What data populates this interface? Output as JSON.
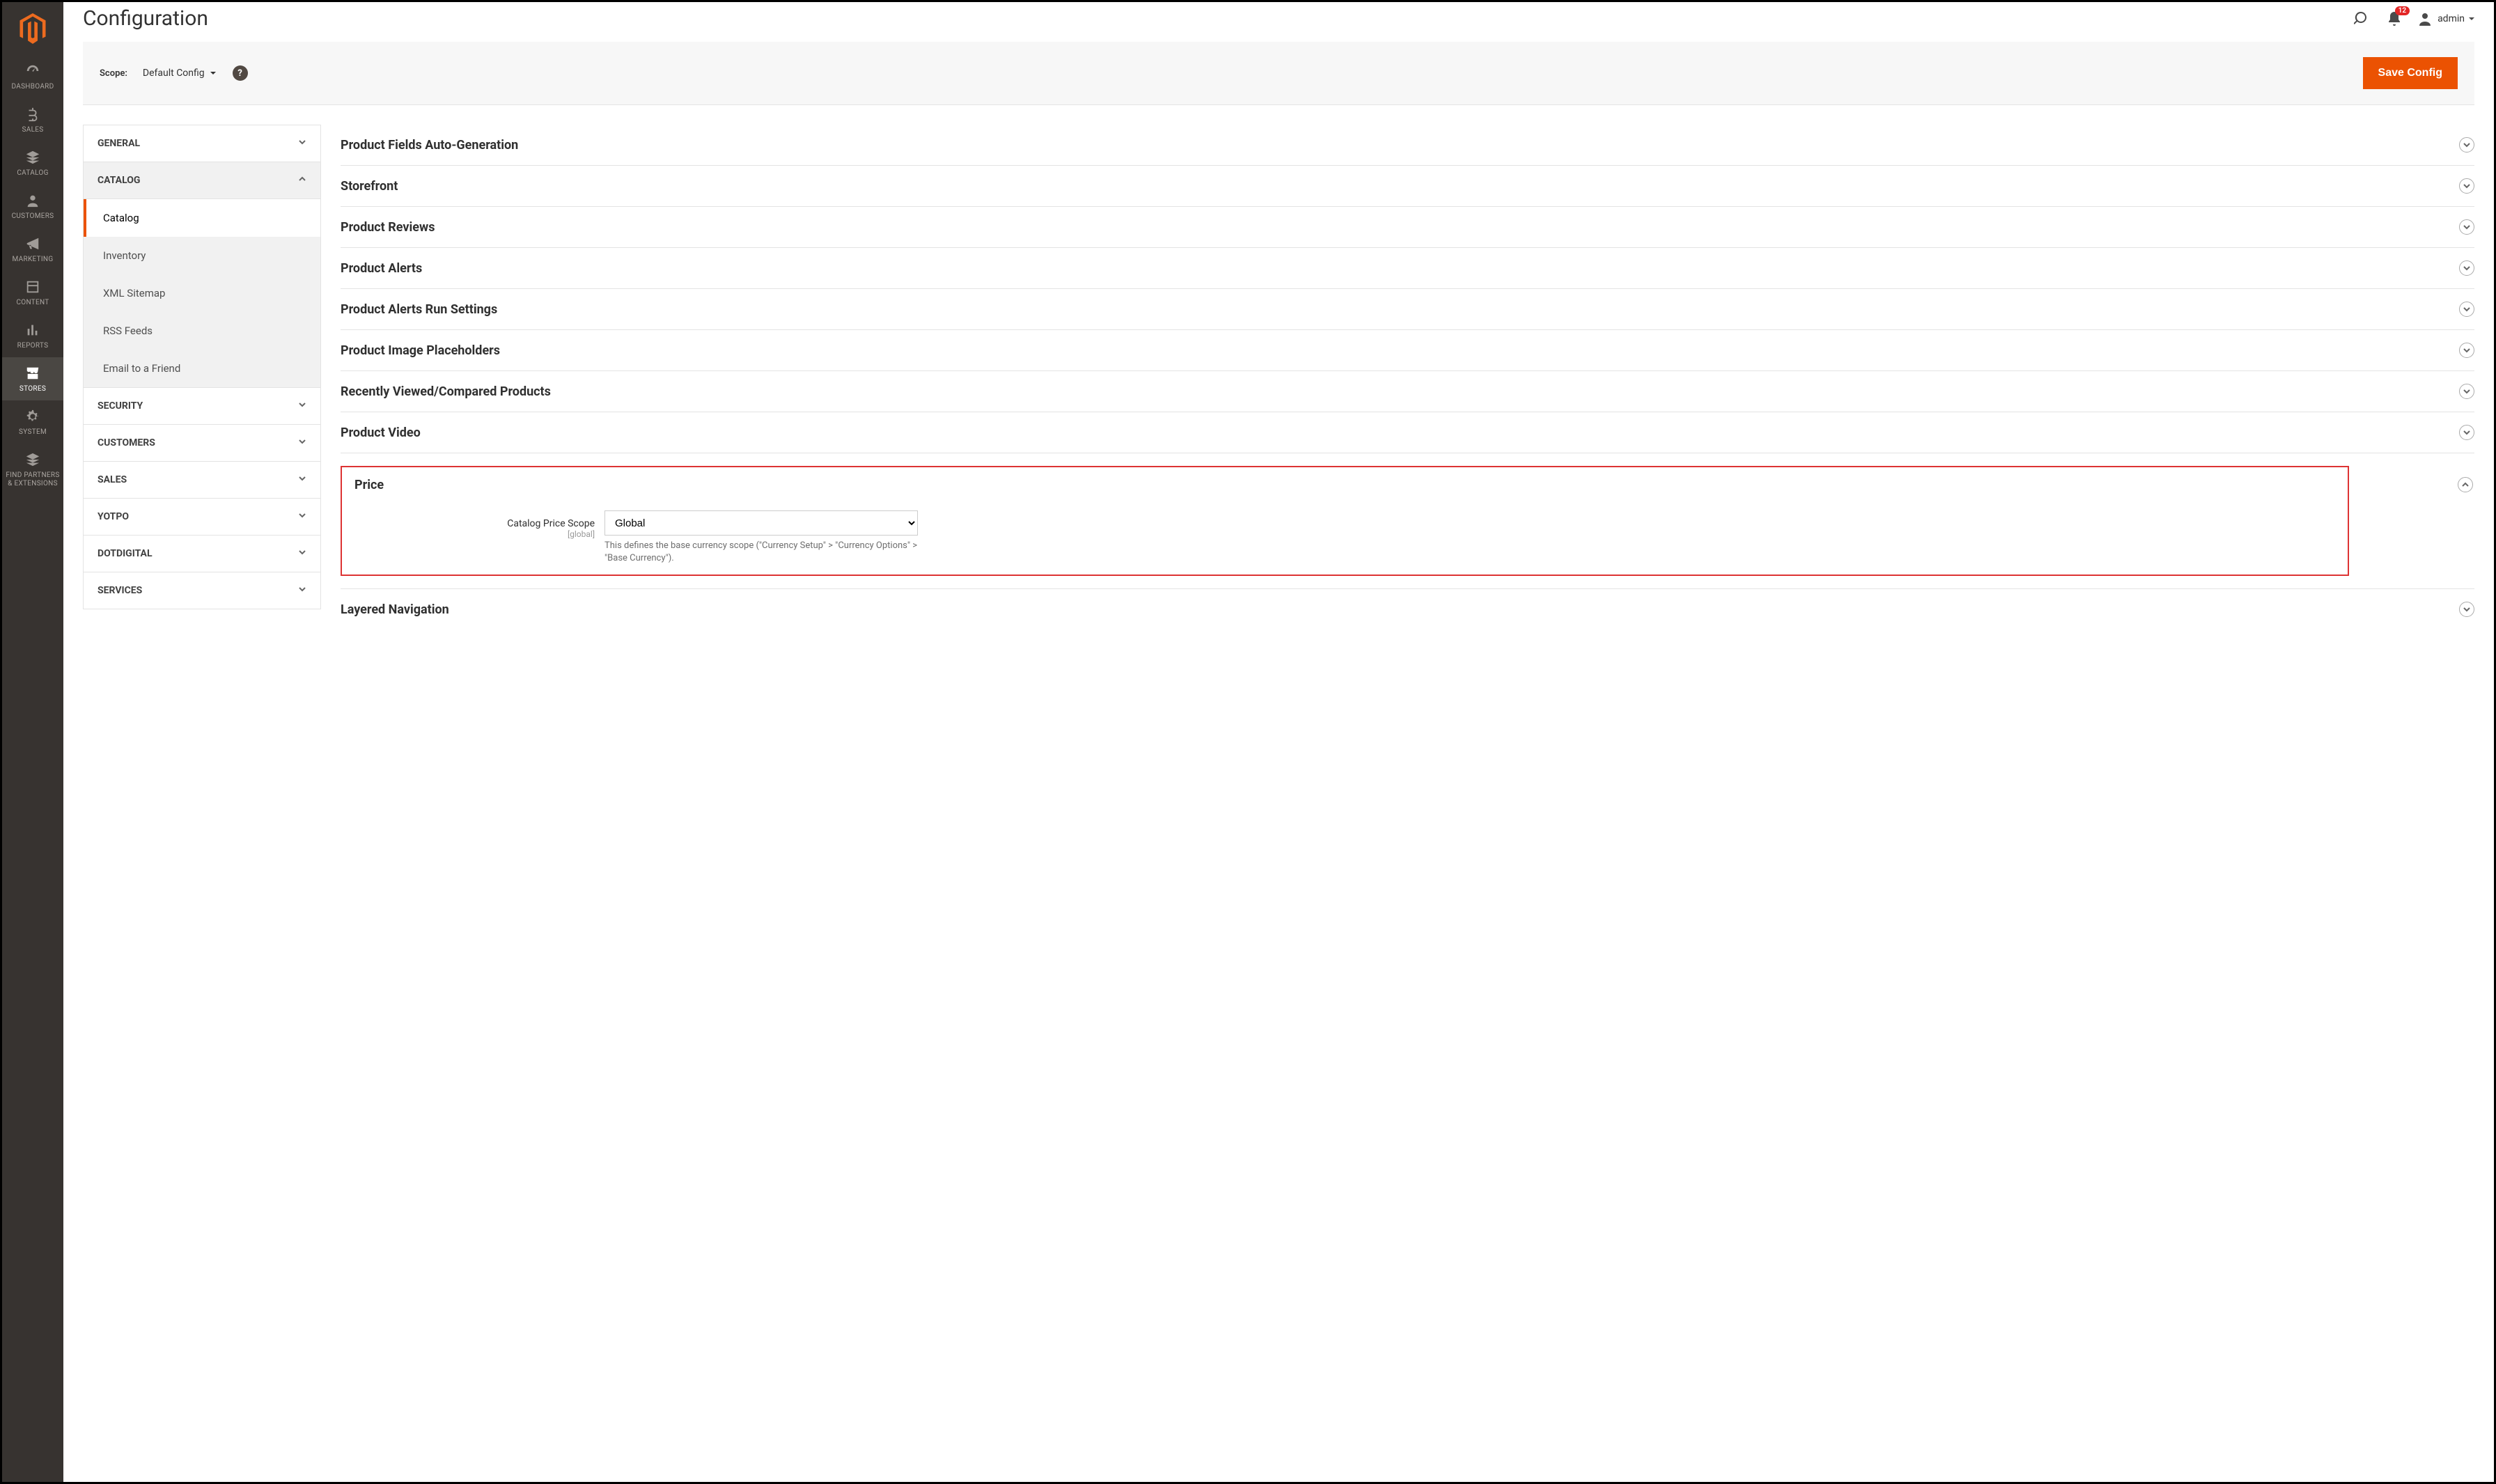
{
  "page_title": "Configuration",
  "header": {
    "notifications_count": "12",
    "user_label": "admin"
  },
  "scope": {
    "label": "Scope:",
    "value": "Default Config"
  },
  "save_button": "Save Config",
  "sidebar": [
    {
      "label": "DASHBOARD"
    },
    {
      "label": "SALES"
    },
    {
      "label": "CATALOG"
    },
    {
      "label": "CUSTOMERS"
    },
    {
      "label": "MARKETING"
    },
    {
      "label": "CONTENT"
    },
    {
      "label": "REPORTS"
    },
    {
      "label": "STORES"
    },
    {
      "label": "SYSTEM"
    },
    {
      "label": "FIND PARTNERS\n& EXTENSIONS"
    }
  ],
  "tabs": {
    "general": "GENERAL",
    "catalog": "CATALOG",
    "catalog_items": [
      "Catalog",
      "Inventory",
      "XML Sitemap",
      "RSS Feeds",
      "Email to a Friend"
    ],
    "security": "SECURITY",
    "customers": "CUSTOMERS",
    "sales": "SALES",
    "yotpo": "YOTPO",
    "dotdigital": "DOTDIGITAL",
    "services": "SERVICES"
  },
  "sections": {
    "s0": "Product Fields Auto-Generation",
    "s1": "Storefront",
    "s2": "Product Reviews",
    "s3": "Product Alerts",
    "s4": "Product Alerts Run Settings",
    "s5": "Product Image Placeholders",
    "s6": "Recently Viewed/Compared Products",
    "s7": "Product Video",
    "s8": "Price",
    "s9": "Layered Navigation"
  },
  "price": {
    "field_label": "Catalog Price Scope",
    "field_scope": "[global]",
    "value": "Global",
    "note": "This defines the base currency scope (\"Currency Setup\" > \"Currency Options\" > \"Base Currency\")."
  }
}
